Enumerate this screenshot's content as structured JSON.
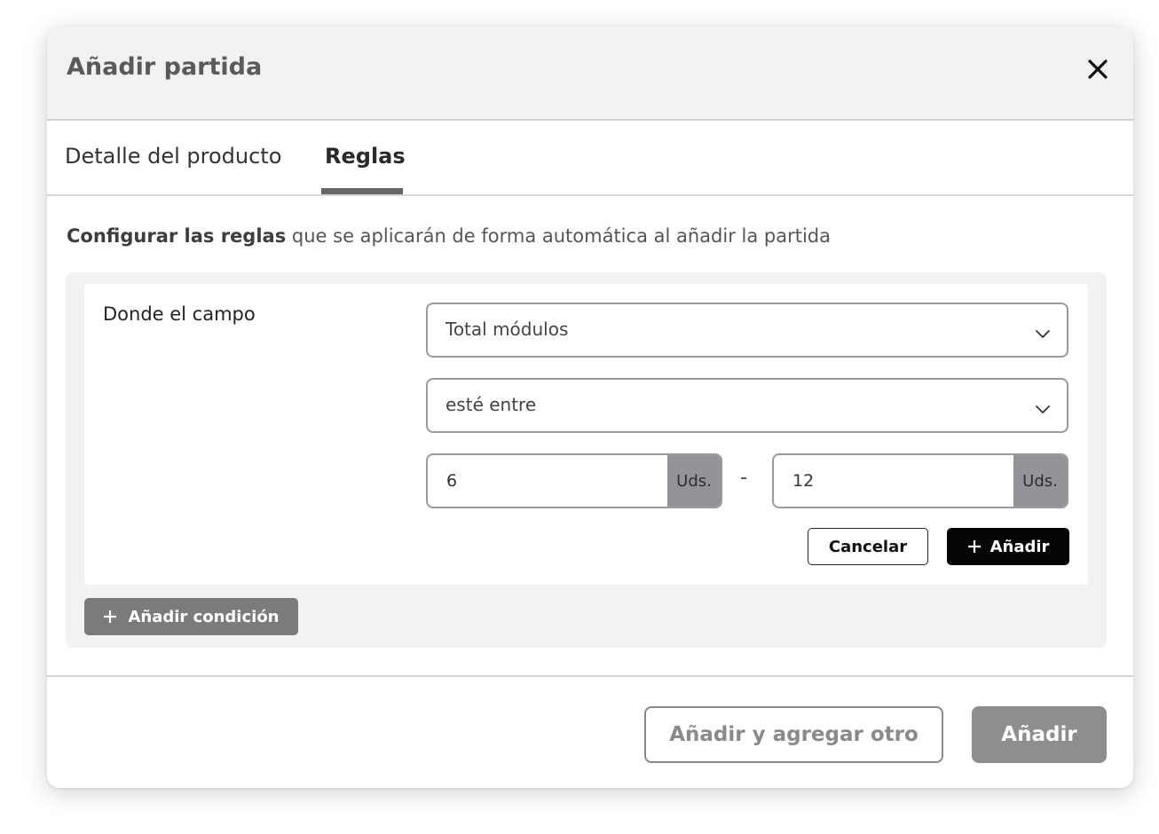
{
  "dialog": {
    "title": "Añadir partida",
    "close_icon": "close-icon"
  },
  "tabs": [
    {
      "label": "Detalle del producto",
      "active": false
    },
    {
      "label": "Reglas",
      "active": true
    }
  ],
  "intro": {
    "bold": "Configurar las reglas",
    "rest": " que se aplicarán de forma automática al añadir la partida"
  },
  "rule": {
    "field_label": "Donde el campo",
    "field_select": {
      "value": "Total módulos",
      "icon": "chevron-down-icon"
    },
    "operator_select": {
      "value": "esté entre",
      "icon": "chevron-down-icon"
    },
    "min": {
      "value": "6",
      "unit": "Uds."
    },
    "separator": "-",
    "max": {
      "value": "12",
      "unit": "Uds."
    },
    "cancel_label": "Cancelar",
    "add_label": "Añadir"
  },
  "add_condition_label": "Añadir condición",
  "footer": {
    "add_another_label": "Añadir y agregar otro",
    "submit_label": "Añadir"
  },
  "colors": {
    "header_bg": "#f1f2f4",
    "primary_black": "#050505",
    "disabled_gray": "#8e8e8e",
    "unit_addon": "#939499"
  }
}
